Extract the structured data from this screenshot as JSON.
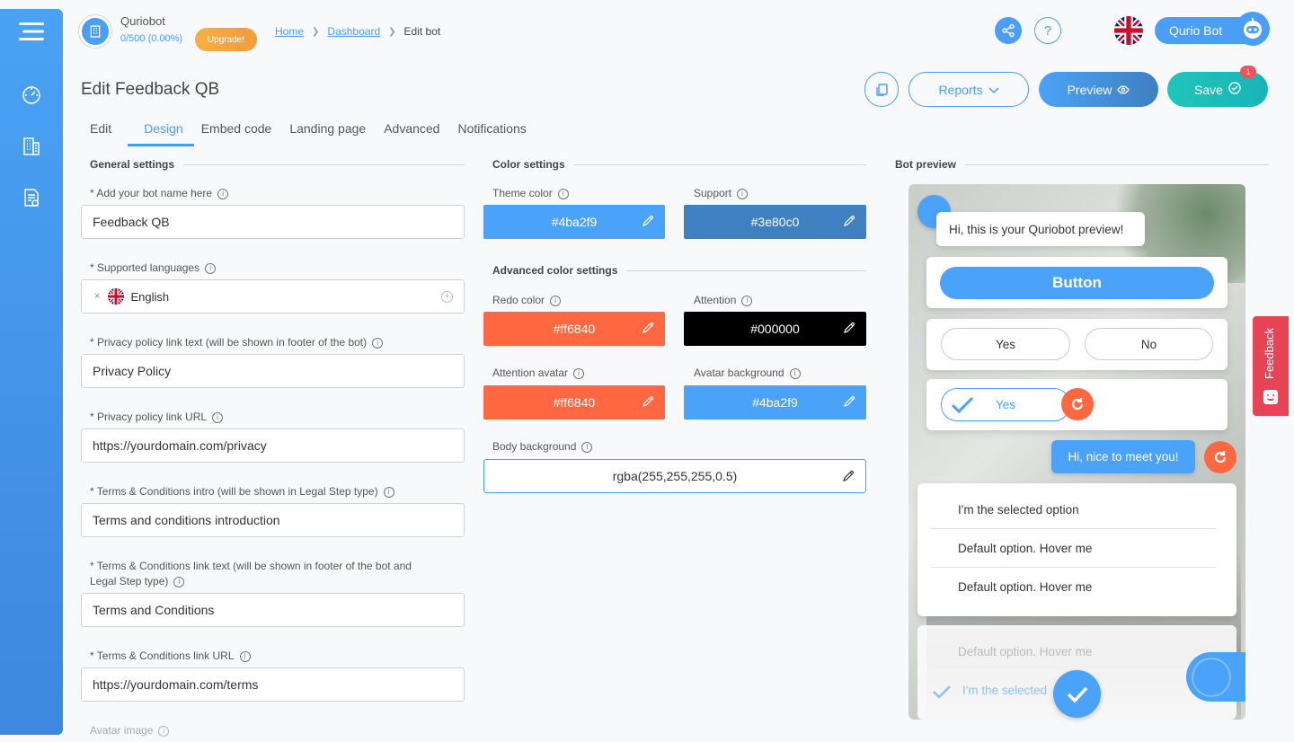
{
  "app": {
    "brand": "Quriobot",
    "usage": "0/500 (0.00%)",
    "upgrade_label": "Upgrade!"
  },
  "breadcrumb": {
    "home": "Home",
    "dashboard": "Dashboard",
    "current": "Edit bot"
  },
  "user": {
    "name": "Qurio Bot"
  },
  "page": {
    "title": "Edit Feedback QB"
  },
  "header_buttons": {
    "reports": "Reports",
    "preview": "Preview",
    "save": "Save",
    "save_badge": "1"
  },
  "tabs": [
    "Edit",
    "Design",
    "Embed code",
    "Landing page",
    "Advanced",
    "Notifications"
  ],
  "general": {
    "heading": "General settings",
    "bot_name_label": "* Add your bot name here",
    "bot_name_value": "Feedback QB",
    "languages_label": "* Supported languages",
    "language_value": "English",
    "privacy_text_label": "* Privacy policy link text (will be shown in footer of the bot)",
    "privacy_text_value": "Privacy Policy",
    "privacy_url_label": "* Privacy policy link URL",
    "privacy_url_value": "https://yourdomain.com/privacy",
    "terms_intro_label": "* Terms & Conditions intro (will be shown in Legal Step type)",
    "terms_intro_value": "Terms and conditions introduction",
    "terms_text_label_1": "* Terms & Conditions link text (will be shown in footer of the bot and",
    "terms_text_label_2": "Legal Step type)",
    "terms_text_value": "Terms and Conditions",
    "terms_url_label": "* Terms & Conditions link URL",
    "terms_url_value": "https://yourdomain.com/terms",
    "avatar_label": "Avatar image"
  },
  "colors": {
    "heading": "Color settings",
    "theme_label": "Theme color",
    "theme_value": "#4ba2f9",
    "support_label": "Support",
    "support_value": "#3e80c0",
    "advanced_heading": "Advanced color settings",
    "redo_label": "Redo color",
    "redo_value": "#ff6840",
    "attention_label": "Attention",
    "attention_value": "#000000",
    "attention_avatar_label": "Attention avatar",
    "attention_avatar_value": "#ff6840",
    "avatar_bg_label": "Avatar background",
    "avatar_bg_value": "#4ba2f9",
    "body_bg_label": "Body background",
    "body_bg_value": "rgba(255,255,255,0.5)"
  },
  "preview": {
    "heading": "Bot preview",
    "greeting": "Hi, this is your Quriobot preview!",
    "button": "Button",
    "yes": "Yes",
    "no": "No",
    "selected_yes": "Yes",
    "user_reply": "Hi, nice to meet you!",
    "options": [
      "I'm the selected option",
      "Default option. Hover me",
      "Default option. Hover me"
    ],
    "faded_option": "Default option. Hover me",
    "faded_selected": "I'm the selected"
  },
  "feedback_tab": {
    "label": "Feedback"
  }
}
